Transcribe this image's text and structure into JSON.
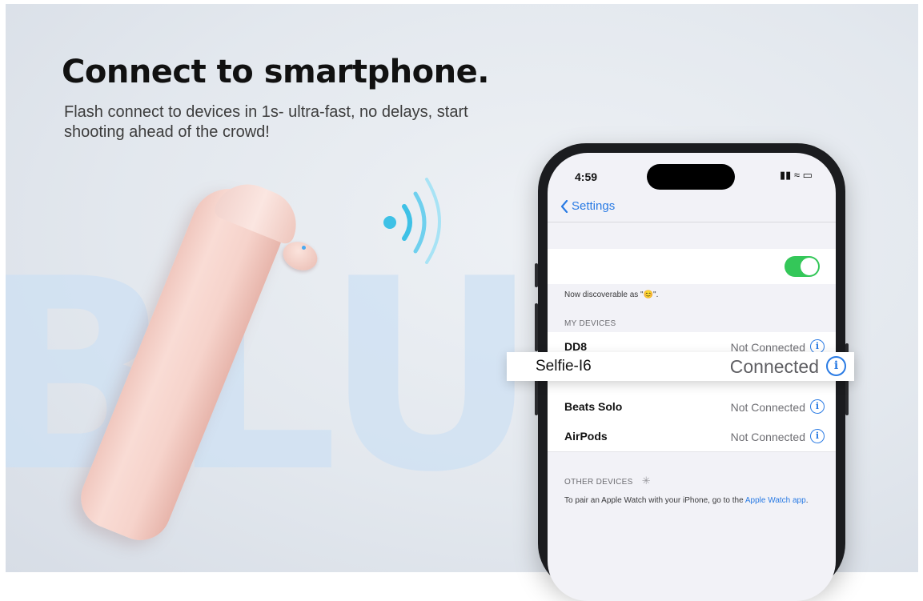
{
  "headline": "Connect to smartphone.",
  "subline": "Flash connect to devices in 1s- ultra-fast, no delays, start shooting ahead of the crowd!",
  "watermark": "BLUE",
  "phone": {
    "time": "4:59",
    "status": "▮▮ ≈ ▭",
    "back_label": "Settings",
    "discoverable": "Now discoverable as \"😊\".",
    "my_devices_header": "MY DEVICES",
    "devices": [
      {
        "name": "DD8",
        "status": "Not Connected"
      },
      {
        "name": "Selfie-I6",
        "status": "Connected"
      },
      {
        "name": "Beats Solo",
        "status": "Not Connected"
      },
      {
        "name": "AirPods",
        "status": "Not Connected"
      }
    ],
    "other_devices_header": "OTHER DEVICES",
    "pair_text": "To pair an Apple Watch with your iPhone, go to the ",
    "pair_link": "Apple Watch app",
    "pair_end": "."
  },
  "colors": {
    "accent": "#2a7be4",
    "toggle_on": "#34c759",
    "signal": "#3ec1e6"
  },
  "icons": [
    "back-chevron-icon",
    "info-icon",
    "wifi-signal-icon",
    "spinner-icon"
  ]
}
